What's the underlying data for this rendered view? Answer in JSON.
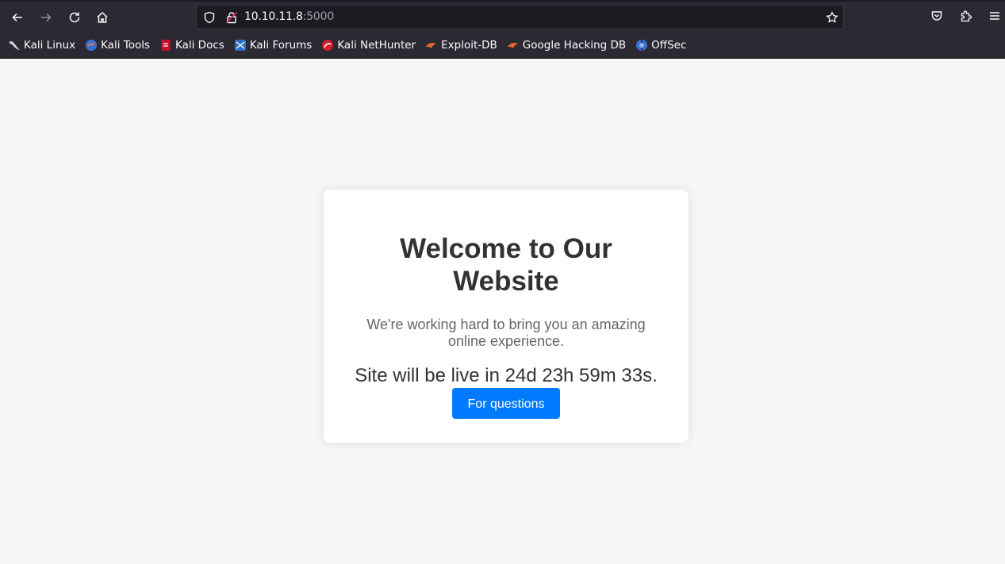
{
  "browser": {
    "url_host": "10.10.11.8",
    "url_port": ":5000",
    "bookmarks": [
      {
        "label": "Kali Linux",
        "icon": "kali-dragon-icon"
      },
      {
        "label": "Kali Tools",
        "icon": "kali-tools-icon"
      },
      {
        "label": "Kali Docs",
        "icon": "kali-docs-icon"
      },
      {
        "label": "Kali Forums",
        "icon": "kali-forums-icon"
      },
      {
        "label": "Kali NetHunter",
        "icon": "kali-nethunter-icon"
      },
      {
        "label": "Exploit-DB",
        "icon": "exploit-db-icon"
      },
      {
        "label": "Google Hacking DB",
        "icon": "ghdb-icon"
      },
      {
        "label": "OffSec",
        "icon": "offsec-icon"
      }
    ]
  },
  "page": {
    "title": "Welcome to Our Website",
    "subtitle": "We're working hard to bring you an amazing online experience.",
    "countdown": "Site will be live in 24d 23h 59m 33s.",
    "button_label": "For questions"
  },
  "colors": {
    "chrome_bg": "#2b2a33",
    "page_bg": "#f6f6f6",
    "button_bg": "#007bff"
  }
}
